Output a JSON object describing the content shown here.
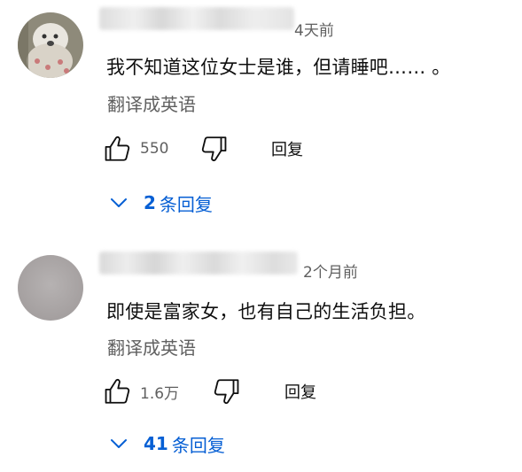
{
  "comments": [
    {
      "time": "4天前",
      "text": "我不知道这位女士是谁，但请睡吧…… 。",
      "translate": "翻译成英语",
      "likes": "550",
      "reply": "回复",
      "replies_count": "2",
      "replies_label": "条回复"
    },
    {
      "time": "2个月前",
      "text": "即使是富家女，也有自己的生活负担。",
      "translate": "翻译成英语",
      "likes": "1.6万",
      "reply": "回复",
      "replies_count": "41",
      "replies_label": "条回复"
    }
  ],
  "icons": {
    "like": "thumb-up-icon",
    "dislike": "thumb-down-icon",
    "expand": "chevron-down-icon"
  },
  "colors": {
    "link": "#065fd4",
    "secondary_text": "#606060",
    "primary_text": "#0f0f0f"
  }
}
